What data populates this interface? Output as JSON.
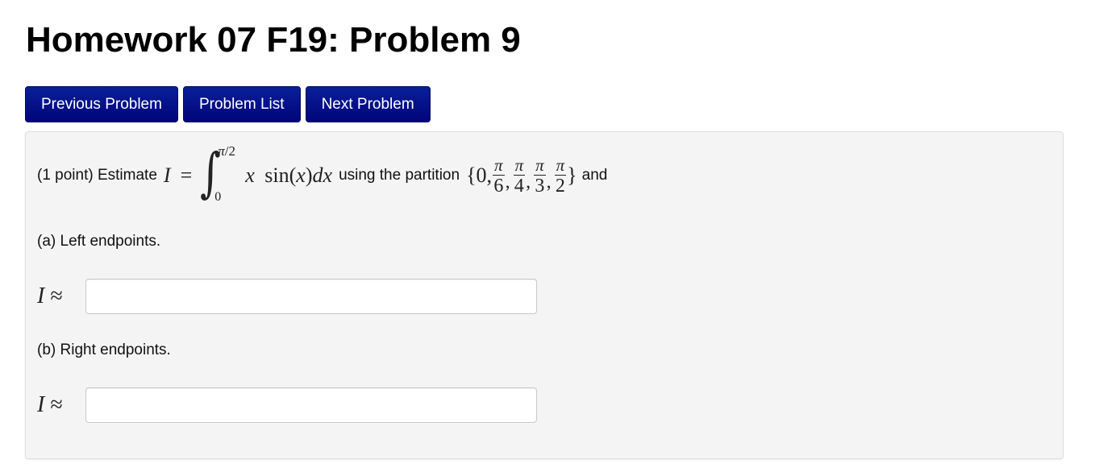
{
  "page": {
    "title": "Homework 07 F19: Problem 9"
  },
  "nav": {
    "previous_label": "Previous Problem",
    "list_label": "Problem List",
    "next_label": "Next Problem",
    "button_color": "#00087f"
  },
  "problem": {
    "points_prefix": "(1 point) Estimate",
    "lhs_var": "I",
    "equals": "=",
    "integral": {
      "sign": "∫",
      "upper_pi": "π",
      "upper_rest": "/2",
      "lower": "0",
      "integrand_x": "x",
      "integrand_sin": "sin(",
      "integrand_arg": "x",
      "integrand_close": ")",
      "differential": "dx"
    },
    "using_text": "using the partition",
    "partition": {
      "open": "{0,",
      "fractions": [
        {
          "num": "π",
          "den": "6"
        },
        {
          "num": "π",
          "den": "4"
        },
        {
          "num": "π",
          "den": "3"
        },
        {
          "num": "π",
          "den": "2"
        }
      ],
      "close": "}"
    },
    "and_text": "and"
  },
  "parts": [
    {
      "label": "(a) Left endpoints.",
      "approx_var": "I",
      "approx_symbol": "≈",
      "input_value": ""
    },
    {
      "label": "(b) Right endpoints.",
      "approx_var": "I",
      "approx_symbol": "≈",
      "input_value": ""
    }
  ]
}
